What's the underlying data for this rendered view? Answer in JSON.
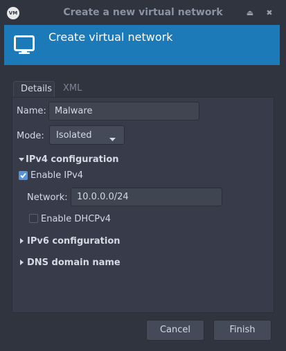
{
  "window": {
    "title": "Create a new virtual network",
    "app_logo": "VM",
    "controls": {
      "minimize": "⏏",
      "close": "✖"
    }
  },
  "banner": {
    "icon": "network-monitor-icon",
    "title": "Create virtual network",
    "color": "#1d7ab8"
  },
  "tabs": [
    {
      "label": "Details",
      "active": true
    },
    {
      "label": "XML",
      "active": false
    }
  ],
  "form": {
    "name_label": "Name:",
    "name_value": "Malware",
    "mode_label": "Mode:",
    "mode_value": "Isolated"
  },
  "ipv4": {
    "title": "IPv4 configuration",
    "expanded": true,
    "enable_label": "Enable IPv4",
    "enable_checked": true,
    "network_label": "Network:",
    "network_value": "10.0.0.0/24",
    "dhcp_label": "Enable DHCPv4",
    "dhcp_checked": false
  },
  "ipv6": {
    "title": "IPv6 configuration",
    "expanded": false
  },
  "dns": {
    "title": "DNS domain name",
    "expanded": false
  },
  "buttons": {
    "cancel": "Cancel",
    "finish": "Finish"
  },
  "colors": {
    "accent": "#5294e2",
    "background": "#2f343f",
    "panel": "#383c4a"
  }
}
